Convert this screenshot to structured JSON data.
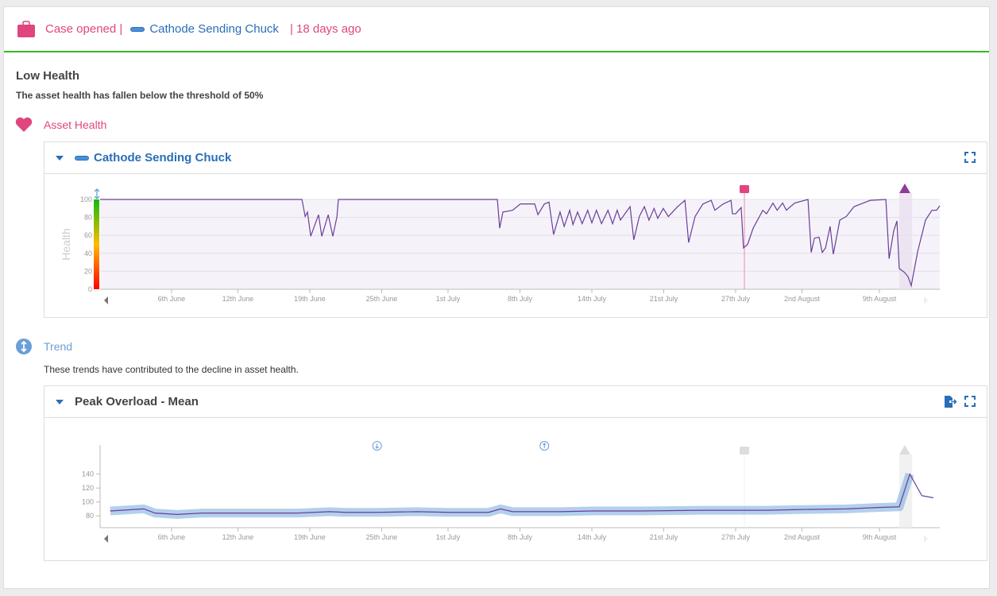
{
  "header": {
    "case_label": "Case opened |",
    "asset_name": "Cathode Sending Chuck",
    "age": "| 18 days ago",
    "icon": "briefcase-icon"
  },
  "alert": {
    "title": "Low Health",
    "description": "The asset health has fallen below the threshold of 50%"
  },
  "asset_health": {
    "section_label": "Asset Health",
    "icon": "heart-icon",
    "panel_title": "Cathode Sending Chuck"
  },
  "trend": {
    "section_label": "Trend",
    "icon": "up-down-circle-icon",
    "description": "These trends have contributed to the decline in asset health.",
    "panel_title": "Peak Overload - Mean"
  },
  "colors": {
    "accent_pink": "#e0457f",
    "accent_blue": "#2a6eb8",
    "header_rule": "#33bb22",
    "series": "#6a3d9a",
    "band": "#7fb1e0"
  },
  "chart_data": [
    {
      "type": "line",
      "ylabel": "Health",
      "ylim": [
        0,
        100
      ],
      "yticks": [
        0,
        20,
        40,
        60,
        80,
        100
      ],
      "xlim": [
        "May 30 13:00",
        "Aug 14 11:00"
      ],
      "xticks": [
        "6th June",
        "12th June",
        "19th June",
        "25th June",
        "1st July",
        "8th July",
        "14th July",
        "21st July",
        "27th July",
        "2nd August",
        "9th August"
      ],
      "xtick_dates": [
        "Jun 6 00:00",
        "Jun 12 00:00",
        "Jun 18 12:00",
        "Jun 25 00:00",
        "Jul 1 00:00",
        "Jul 7 12:00",
        "Jul 14 00:00",
        "Jul 20 12:00",
        "Jul 27 00:00",
        "Aug 2 00:00",
        "Aug 9 00:00"
      ],
      "case_opened_marker": "Jul 27 19:00",
      "alert_band": [
        "Aug 10 19:00",
        "Aug 11 23:00"
      ],
      "series": [
        {
          "points": [
            [
              "May 30 13:00",
              100
            ],
            [
              "Jun 17 19:00",
              100
            ],
            [
              "Jun 18 02:00",
              81
            ],
            [
              "Jun 18 07:00",
              86
            ],
            [
              "Jun 18 14:00",
              59
            ],
            [
              "Jun 19 07:00",
              83
            ],
            [
              "Jun 19 14:00",
              59
            ],
            [
              "Jun 20 04:00",
              83
            ],
            [
              "Jun 20 14:00",
              59
            ],
            [
              "Jun 20 23:00",
              81
            ],
            [
              "Jun 21 02:00",
              100
            ],
            [
              "Jul 5 11:00",
              100
            ],
            [
              "Jul 5 16:00",
              68
            ],
            [
              "Jul 5 23:00",
              86
            ],
            [
              "Jul 6 20:00",
              88
            ],
            [
              "Jul 7 13:00",
              95
            ],
            [
              "Jul 8 20:00",
              95
            ],
            [
              "Jul 9 03:00",
              83
            ],
            [
              "Jul 9 17:00",
              95
            ],
            [
              "Jul 10 03:00",
              97
            ],
            [
              "Jul 10 13:00",
              61
            ],
            [
              "Jul 11 03:00",
              86
            ],
            [
              "Jul 11 12:00",
              70
            ],
            [
              "Jul 12 00:00",
              88
            ],
            [
              "Jul 12 07:00",
              72
            ],
            [
              "Jul 12 17:00",
              86
            ],
            [
              "Jul 13 03:00",
              73
            ],
            [
              "Jul 13 15:00",
              88
            ],
            [
              "Jul 14 00:00",
              74
            ],
            [
              "Jul 14 10:00",
              88
            ],
            [
              "Jul 14 21:00",
              73
            ],
            [
              "Jul 15 11:00",
              88
            ],
            [
              "Jul 15 21:00",
              73
            ],
            [
              "Jul 16 07:00",
              88
            ],
            [
              "Jul 16 14:00",
              77
            ],
            [
              "Jul 17 11:00",
              92
            ],
            [
              "Jul 17 19:00",
              55
            ],
            [
              "Jul 18 07:00",
              81
            ],
            [
              "Jul 18 18:00",
              92
            ],
            [
              "Jul 19 04:00",
              77
            ],
            [
              "Jul 19 15:00",
              90
            ],
            [
              "Jul 19 23:00",
              79
            ],
            [
              "Jul 20 11:00",
              90
            ],
            [
              "Jul 20 22:00",
              81
            ],
            [
              "Jul 21 18:00",
              92
            ],
            [
              "Jul 22 10:00",
              99
            ],
            [
              "Jul 22 18:00",
              52
            ],
            [
              "Jul 23 08:00",
              81
            ],
            [
              "Jul 24 01:00",
              95
            ],
            [
              "Jul 24 19:00",
              99
            ],
            [
              "Jul 25 03:00",
              88
            ],
            [
              "Jul 25 21:00",
              95
            ],
            [
              "Jul 26 14:00",
              99
            ],
            [
              "Jul 26 17:00",
              84
            ],
            [
              "Jul 27 00:00",
              84
            ],
            [
              "Jul 27 12:00",
              91
            ],
            [
              "Jul 27 17:00",
              46
            ],
            [
              "Jul 28 02:00",
              50
            ],
            [
              "Jul 28 14:00",
              68
            ],
            [
              "Jul 29 11:00",
              88
            ],
            [
              "Jul 29 19:00",
              84
            ],
            [
              "Jul 30 09:00",
              96
            ],
            [
              "Jul 30 18:00",
              88
            ],
            [
              "Jul 31 06:00",
              96
            ],
            [
              "Jul 31 14:00",
              88
            ],
            [
              "Aug 1 08:00",
              96
            ],
            [
              "Aug 2 13:00",
              100
            ],
            [
              "Aug 2 20:00",
              41
            ],
            [
              "Aug 3 03:00",
              57
            ],
            [
              "Aug 3 13:00",
              58
            ],
            [
              "Aug 3 20:00",
              41
            ],
            [
              "Aug 4 03:00",
              46
            ],
            [
              "Aug 4 13:00",
              70
            ],
            [
              "Aug 4 20:00",
              39
            ],
            [
              "Aug 5 10:00",
              77
            ],
            [
              "Aug 6 00:00",
              81
            ],
            [
              "Aug 6 17:00",
              92
            ],
            [
              "Aug 8 04:00",
              99
            ],
            [
              "Aug 9 14:00",
              100
            ],
            [
              "Aug 9 21:00",
              34
            ],
            [
              "Aug 10 07:00",
              65
            ],
            [
              "Aug 10 14:00",
              76
            ],
            [
              "Aug 10 19:00",
              23
            ],
            [
              "Aug 11 06:00",
              19
            ],
            [
              "Aug 11 14:00",
              14
            ],
            [
              "Aug 11 21:00",
              4
            ],
            [
              "Aug 12 11:00",
              42
            ],
            [
              "Aug 13 04:00",
              77
            ],
            [
              "Aug 13 18:00",
              88
            ],
            [
              "Aug 14 04:00",
              88
            ],
            [
              "Aug 14 11:00",
              93
            ]
          ]
        }
      ]
    },
    {
      "type": "line",
      "ylim": [
        63,
        159
      ],
      "yticks": [
        80,
        100,
        120,
        140
      ],
      "xlim": [
        "May 30 13:00",
        "Aug 14 11:00"
      ],
      "xticks": [
        "6th June",
        "12th June",
        "19th June",
        "25th June",
        "1st July",
        "8th July",
        "14th July",
        "21st July",
        "27th July",
        "2nd August",
        "9th August"
      ],
      "xtick_dates": [
        "Jun 6 00:00",
        "Jun 12 00:00",
        "Jun 18 12:00",
        "Jun 25 00:00",
        "Jul 1 00:00",
        "Jul 7 12:00",
        "Jul 14 00:00",
        "Jul 20 12:00",
        "Jul 27 00:00",
        "Aug 2 00:00",
        "Aug 9 00:00"
      ],
      "case_opened_marker": "Jul 27 19:00",
      "alert_band": [
        "Aug 10 19:00",
        "Aug 11 23:00"
      ],
      "trend_down_marker": "Jun 24 14:00",
      "trend_up_marker": "Jul 9 17:00",
      "series": [
        {
          "points": [
            [
              "May 31 11:00",
              87
            ],
            [
              "Jun 3 12:00",
              90
            ],
            [
              "Jun 4 12:00",
              84
            ],
            [
              "Jun 6 12:00",
              82
            ],
            [
              "Jun 8 19:00",
              84
            ],
            [
              "Jun 11 16:00",
              84
            ],
            [
              "Jun 14 13:00",
              84
            ],
            [
              "Jun 17 10:00",
              84
            ],
            [
              "Jun 18 21:00",
              85
            ],
            [
              "Jun 20 07:00",
              86
            ],
            [
              "Jun 21 18:00",
              85
            ],
            [
              "Jun 24 14:00",
              85
            ],
            [
              "Jun 28 05:00",
              86
            ],
            [
              "Jul 1 02:00",
              85
            ],
            [
              "Jul 4 16:00",
              85
            ],
            [
              "Jul 5 18:00",
              90
            ],
            [
              "Jul 6 20:00",
              86
            ],
            [
              "Jul 11 03:00",
              86
            ],
            [
              "Jul 14 00:00",
              87
            ],
            [
              "Jul 18 07:00",
              87
            ],
            [
              "Jul 24 01:00",
              88
            ],
            [
              "Jul 29 19:00",
              88
            ],
            [
              "Aug 1 16:00",
              89
            ],
            [
              "Aug 6 00:00",
              90
            ],
            [
              "Aug 8 21:00",
              92
            ],
            [
              "Aug 10 19:00",
              93
            ],
            [
              "Aug 11 18:00",
              140
            ],
            [
              "Aug 12 20:00",
              109
            ],
            [
              "Aug 13 21:00",
              106
            ]
          ],
          "band_until": "Aug 11 18:00"
        }
      ]
    }
  ]
}
